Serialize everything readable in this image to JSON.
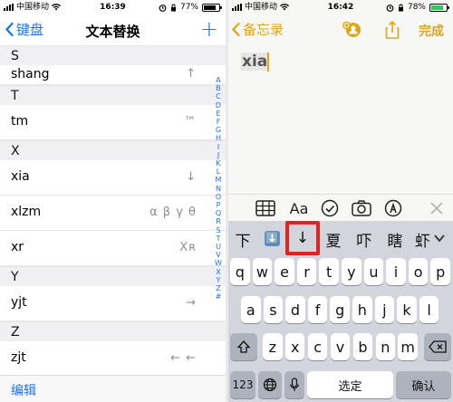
{
  "left": {
    "status": {
      "carrier": "中国移动",
      "time": "16:39",
      "battery": "77%"
    },
    "nav": {
      "back_label": "键盘",
      "title": "文本替换",
      "add_label": "+"
    },
    "sections": [
      {
        "letter": "S",
        "rows": [
          {
            "key": "shang",
            "value": "↑"
          }
        ]
      },
      {
        "letter": "T",
        "rows": [
          {
            "key": "tm",
            "value": "™"
          }
        ]
      },
      {
        "letter": "X",
        "rows": [
          {
            "key": "xia",
            "value": "↓"
          },
          {
            "key": "xlzm",
            "value": "α β γ θ"
          },
          {
            "key": "xr",
            "value": "Xʀ"
          }
        ]
      },
      {
        "letter": "Y",
        "rows": [
          {
            "key": "yjt",
            "value": "→"
          }
        ]
      },
      {
        "letter": "Z",
        "rows": [
          {
            "key": "zjt",
            "value": "← ←"
          }
        ]
      }
    ],
    "index_letters": [
      "A",
      "B",
      "C",
      "D",
      "E",
      "F",
      "G",
      "H",
      "I",
      "J",
      "K",
      "L",
      "M",
      "N",
      "O",
      "P",
      "Q",
      "R",
      "S",
      "T",
      "U",
      "V",
      "W",
      "X",
      "Y",
      "Z",
      "#"
    ],
    "edit_label": "编辑"
  },
  "right": {
    "status": {
      "carrier": "中国移动",
      "time": "16:42",
      "battery": "78%"
    },
    "nav": {
      "back_label": "备忘录",
      "done_label": "完成"
    },
    "note_text": "xia",
    "format_bar": {
      "text_style": "Aa"
    },
    "candidates": [
      "下",
      "⬇️",
      "↓",
      "夏",
      "吓",
      "瞎",
      "虾"
    ],
    "keyboard": {
      "row1": [
        "q",
        "w",
        "e",
        "r",
        "t",
        "y",
        "u",
        "i",
        "o",
        "p"
      ],
      "row2": [
        "a",
        "s",
        "d",
        "f",
        "g",
        "h",
        "j",
        "k",
        "l"
      ],
      "row3": [
        "z",
        "x",
        "c",
        "v",
        "b",
        "n",
        "m"
      ],
      "num_label": "123",
      "space_label": "选定",
      "return_label": "确认"
    },
    "accent_color": "#e0a514",
    "highlight_color": "#e8221b"
  }
}
